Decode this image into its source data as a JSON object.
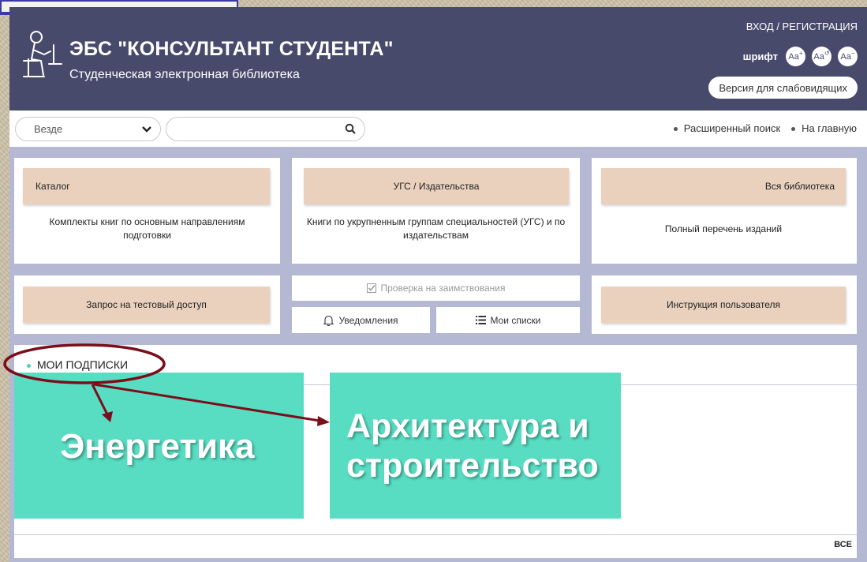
{
  "header": {
    "title": "ЭБС \"КОНСУЛЬТАНТ СТУДЕНТА\"",
    "subtitle": "Студенческая электронная библиотека",
    "login": "ВХОД / РЕГИСТРАЦИЯ",
    "font_label": "шрифт",
    "font_buttons": [
      "Aa",
      "Aa",
      "Aa"
    ],
    "vision_version": "Версия для слабовидящих"
  },
  "search": {
    "scope_value": "Везде",
    "query": "",
    "advanced": "Расширенный поиск",
    "home": "На главную"
  },
  "cards": {
    "catalog": {
      "title": "Каталог",
      "desc": "Комплекты книг по основным направлениям подготовки"
    },
    "ugs": {
      "title": "УГС / Издательства",
      "desc": "Книги по укрупненным группам специальностей (УГС) и по издательствам"
    },
    "library": {
      "title": "Вся библиотека",
      "desc": "Полный перечень изданий"
    },
    "test_access": {
      "title": "Запрос на тестовый доступ"
    },
    "manual": {
      "title": "Инструкция пользователя"
    }
  },
  "buttons": {
    "plagiarism": "Проверка на заимствования",
    "notifications": "Уведомления",
    "my_lists": "Мои списки"
  },
  "subscriptions": {
    "title": "МОИ ПОДПИСКИ",
    "all": "ВСЕ",
    "tiles": [
      "Энергетика",
      "Архитектура и строительство"
    ]
  },
  "colors": {
    "header_bg": "#484a6c",
    "page_bg": "#b5b8d2",
    "card_head": "#ead1bd",
    "tile": "#58ddc3",
    "annotation": "#7a0e1a"
  }
}
